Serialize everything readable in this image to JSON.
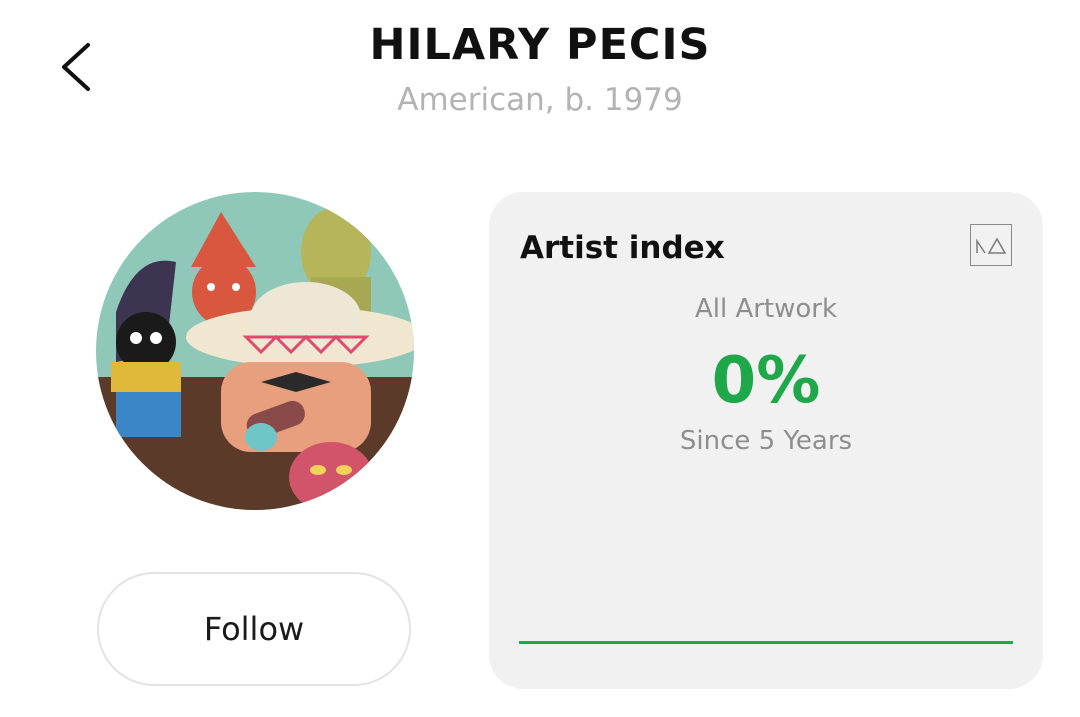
{
  "header": {
    "artist_name": "HILARY PECIS",
    "artist_meta": "American, b. 1979"
  },
  "profile": {
    "follow_label": "Follow"
  },
  "artist_index": {
    "title": "Artist index",
    "scope": "All Artwork",
    "value": "0%",
    "period": "Since 5 Years",
    "accent_color": "#1fa84a",
    "logo_icon": "artist-index-logo-icon",
    "trend_line": [
      0,
      0
    ]
  },
  "icons": {
    "back": "chevron-left-icon"
  }
}
